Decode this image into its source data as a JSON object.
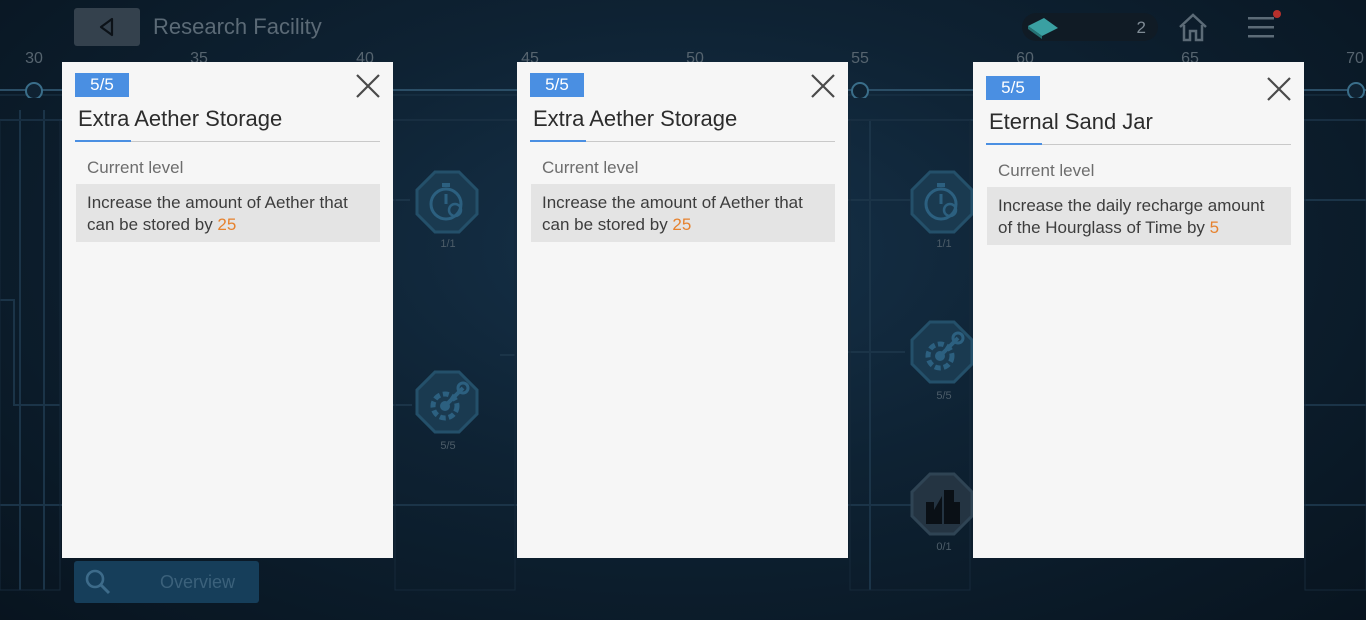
{
  "header": {
    "title": "Research Facility",
    "currency_count": "2"
  },
  "ruler": {
    "ticks": [
      "30",
      "35",
      "40",
      "45",
      "50",
      "55",
      "60",
      "65",
      "70"
    ]
  },
  "nodes": [
    {
      "icon": "stopwatch-icon",
      "count": "1/1"
    },
    {
      "icon": "gear-wrench-icon",
      "count": "5/5"
    },
    {
      "icon": "stopwatch-icon",
      "count": "1/1"
    },
    {
      "icon": "gear-wrench-icon",
      "count": "5/5"
    },
    {
      "icon": "city-buildings-icon",
      "count": "0/1"
    }
  ],
  "footer": {
    "overview_label": "Overview"
  },
  "cards": [
    {
      "level": "5/5",
      "title": "Extra Aether Storage",
      "section_label": "Current level",
      "desc_prefix": "Increase the amount of Aether that can be stored by ",
      "desc_value": "25"
    },
    {
      "level": "5/5",
      "title": "Extra Aether Storage",
      "section_label": "Current level",
      "desc_prefix": "Increase the amount of Aether that can be stored by ",
      "desc_value": "25"
    },
    {
      "level": "5/5",
      "title": "Eternal Sand Jar",
      "section_label": "Current level",
      "desc_prefix": "Increase the daily recharge amount of the Hourglass of Time by ",
      "desc_value": "5"
    }
  ],
  "colors": {
    "badge": "#4a8fe2",
    "highlight": "#e6822e",
    "card_bg": "#f6f6f6"
  }
}
